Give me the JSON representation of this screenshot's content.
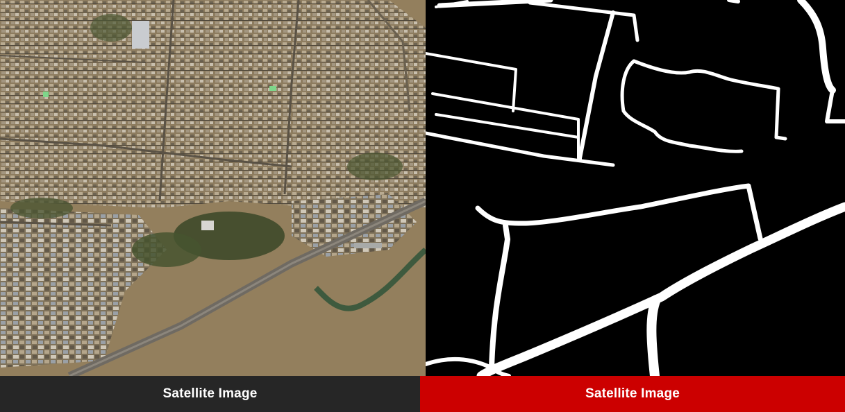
{
  "captions": {
    "left": "Satellite Image",
    "right": "Satellite Image"
  },
  "colors": {
    "left_caption_bg": "#262626",
    "right_caption_bg": "#cc0000",
    "caption_text": "#ffffff",
    "mask_background": "#000000",
    "mask_roads": "#ffffff"
  }
}
